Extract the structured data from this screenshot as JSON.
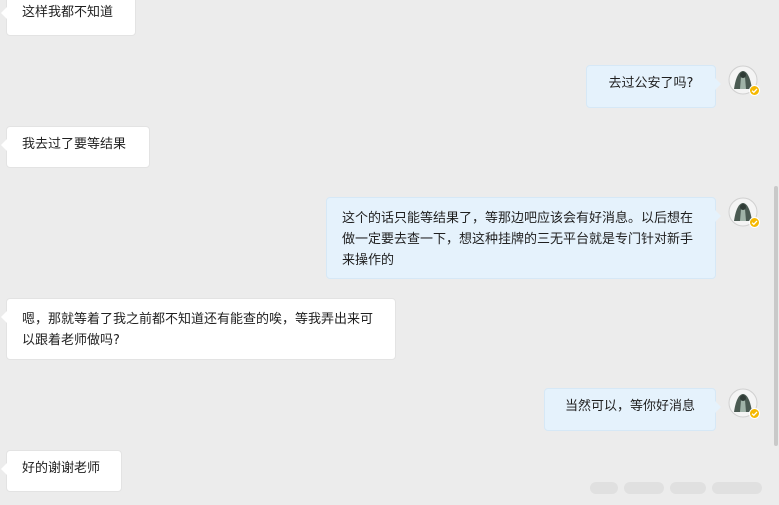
{
  "conversation": {
    "messages": [
      {
        "side": "in",
        "text": "这样我都不知道"
      },
      {
        "side": "out",
        "text": "去过公安了吗?"
      },
      {
        "side": "in",
        "text": "我去过了要等结果"
      },
      {
        "side": "out",
        "text": "这个的话只能等结果了，等那边吧应该会有好消息。以后想在做一定要去查一下，想这种挂牌的三无平台就是专门针对新手来操作的"
      },
      {
        "side": "in",
        "text": "嗯，那就等着了我之前都不知道还有能查的唉，等我弄出来可以跟着老师做吗?"
      },
      {
        "side": "out",
        "text": "当然可以，等你好消息"
      },
      {
        "side": "in",
        "text": "好的谢谢老师"
      }
    ]
  },
  "colors": {
    "background": "#ececec",
    "incoming_bubble": "#ffffff",
    "outgoing_bubble": "#e5f2fc",
    "verified_badge": "#f5b800"
  },
  "icons": {
    "avatar": "user-avatar-icon",
    "badge": "verified-badge-icon"
  }
}
